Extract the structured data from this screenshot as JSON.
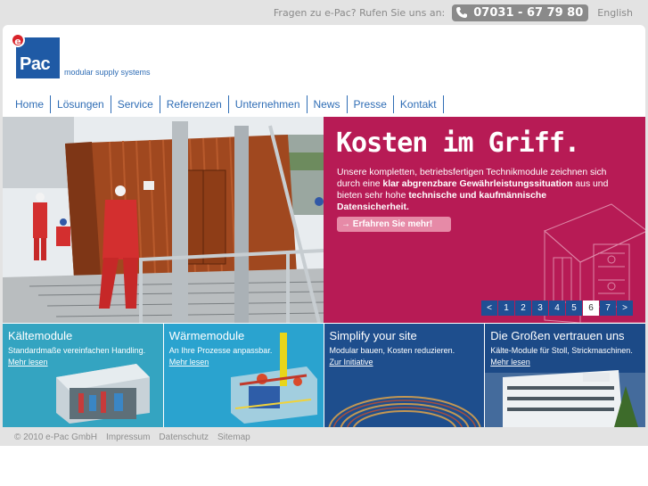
{
  "topbar": {
    "question": "Fragen zu e-Pac? Rufen Sie uns an:",
    "phone": "07031 - 67 79 80",
    "language": "English"
  },
  "logo": {
    "badge": "e",
    "text": "Pac",
    "tagline": "modular supply systems"
  },
  "nav": [
    "Home",
    "Lösungen",
    "Service",
    "Referenzen",
    "Unternehmen",
    "News",
    "Presse",
    "Kontakt"
  ],
  "hero": {
    "title": "Kosten im Griff.",
    "text_parts": [
      {
        "t": "Unsere kompletten, betriebsfertigen Technikmodule zeichnen sich durch eine ",
        "b": false
      },
      {
        "t": "klar abgrenzbare Gewährleistungssituation",
        "b": true
      },
      {
        "t": " aus und bieten sehr hohe ",
        "b": false
      },
      {
        "t": "technische und kaufmännische Datensicherheit.",
        "b": true
      }
    ],
    "button": "Erfahren Sie mehr!",
    "pager": [
      "<",
      "1",
      "2",
      "3",
      "4",
      "5",
      "6",
      "7",
      ">"
    ],
    "active_page": "6",
    "colors": {
      "promo_bg": "#b71b55",
      "pager_bg": "#1f4f94"
    }
  },
  "tiles": [
    {
      "title": "Kältemodule",
      "subtitle": "Standardmaße vereinfachen Handling.",
      "link": "Mehr lesen",
      "color": "#3aa9c4"
    },
    {
      "title": "Wärmemodule",
      "subtitle": "An Ihre Prozesse anpassbar.",
      "link": "Mehr lesen",
      "color": "#2aa3cf"
    },
    {
      "title": "Simplify your site",
      "subtitle": "Modular bauen, Kosten reduzieren.",
      "link": "Zur Initiative",
      "color": "#1e4e8d"
    },
    {
      "title": "Die Großen vertrauen uns",
      "subtitle": "Kälte-Module für Stoll, Strickmaschinen.",
      "link": "Mehr lesen",
      "color": "#1c4a87"
    }
  ],
  "footer": [
    "© 2010 e-Pac GmbH",
    "Impressum",
    "Datenschutz",
    "Sitemap"
  ]
}
